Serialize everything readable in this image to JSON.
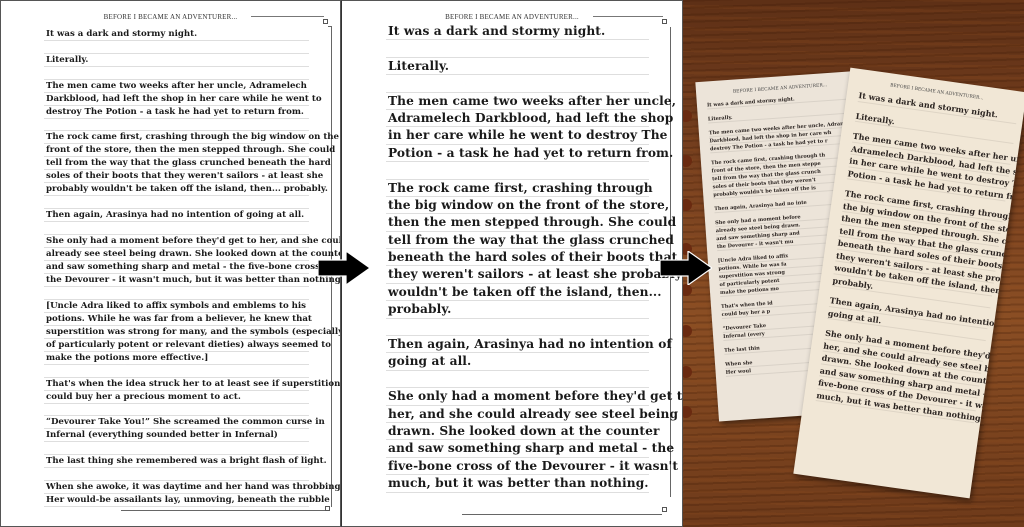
{
  "header": "BEFORE I BECAME AN ADVENTURER...",
  "left_page": {
    "paragraphs": [
      [
        "It was a dark and stormy night."
      ],
      [
        "Literally."
      ],
      [
        "The men came two weeks after her uncle, Adramelech",
        "Darkblood, had left the shop in her care while he went to",
        "destroy The Potion - a task he had yet to return from."
      ],
      [
        "The rock came first, crashing through the big window on the",
        "front of the store, then the men stepped through. She could",
        "tell from the way that the glass crunched beneath the hard",
        "soles of their boots that they weren't sailors - at least she",
        "probably wouldn't be taken off the island, then... probably."
      ],
      [
        "Then again, Arasinya had no intention of going at all."
      ],
      [
        "She only had a moment before they'd get to her, and she could",
        "already see steel being drawn. She looked down at the counter",
        "and saw something sharp and metal - the five-bone cross of",
        "the Devourer - it wasn't much, but it was better than nothing."
      ],
      [
        "[Uncle Adra liked to affix symbols and emblems to his",
        "potions. While he was far from a believer, he knew that",
        "superstition was strong for many, and the symbols (especially",
        "of particularly potent or relevant dieties) always seemed to",
        "make the potions more effective.]"
      ],
      [
        "That's when the idea struck her to at least see if superstition",
        "could buy her a precious moment to act."
      ],
      [
        "“Devourer Take You!” She screamed the common curse in",
        "Infernal (everything sounded better in Infernal)"
      ],
      [
        "The last thing she remembered was a bright flash of light."
      ],
      [
        "When she awoke, it was daytime and her hand was throbbing.",
        "Her would-be assailants lay, unmoving, beneath the rubble"
      ]
    ]
  },
  "mid_page": {
    "paragraphs": [
      [
        "It was a dark and stormy night."
      ],
      [
        "Literally."
      ],
      [
        "The men came two weeks after her uncle,",
        "Adramelech Darkblood, had left the shop",
        "in her care while he went to destroy The",
        "Potion - a task he had yet to return from."
      ],
      [
        "The rock came first, crashing through",
        "the big window on the front of the store,",
        "then the men stepped through. She could",
        "tell from the way that the glass crunched",
        "beneath the hard soles of their boots that",
        "they weren't sailors - at least she probably",
        "wouldn't be taken off the island, then...",
        "probably."
      ],
      [
        "Then again, Arasinya had no intention of",
        "going at all."
      ],
      [
        "She only had a moment before they'd get to",
        "her, and she could already see steel being",
        "drawn. She looked down at the counter",
        "and saw something sharp and metal - the",
        "five-bone cross of the Devourer - it wasn't",
        "much, but it was better than nothing."
      ]
    ]
  },
  "photo": {
    "back_sheet": {
      "paragraphs": [
        [
          "It was a dark and stormy night."
        ],
        [
          "Literally."
        ],
        [
          "The men came two weeks after her uncle, Adrame",
          "Darkblood, had left the shop in her care wh",
          "destroy The Potion - a task he had yet to r"
        ],
        [
          "The rock came first, crashing through th",
          "front of the store, then the men steppe",
          "tell from the way that the glass crunch",
          "soles of their boots that they weren't",
          "probably wouldn't be taken off the is"
        ],
        [
          "Then again, Arasinya had no inte"
        ],
        [
          "She only had a moment before",
          "already see steel being drawn.",
          "and saw something sharp and",
          "the Devourer - it wasn't mu"
        ],
        [
          "[Uncle Adra liked to affix",
          "potions. While he was fa",
          "superstition was strong",
          "of particularly potent",
          "make the potions mo"
        ],
        [
          "That's when the id",
          "could buy her a p"
        ],
        [
          "“Devourer Take",
          "Infernal (every"
        ],
        [
          "The last thin"
        ],
        [
          "When she",
          "Her woul"
        ]
      ]
    },
    "front_sheet": {
      "paragraphs": [
        [
          "It was a dark and stormy night."
        ],
        [
          "Literally."
        ],
        [
          "The men came two weeks after her uncle,",
          "Adramelech Darkblood, had left the shop",
          "in her care while he went to destroy The",
          "Potion - a task he had yet to return from."
        ],
        [
          "The rock came first, crashing through",
          "the big window on the front of the store,",
          "then the men stepped through. She could",
          "tell from the way that the glass crunched",
          "beneath the hard soles of their boots that",
          "they weren't sailors - at least she probably",
          "wouldn't be taken off the island, then...",
          "probably."
        ],
        [
          "Then again, Arasinya had no intention of",
          "going at all."
        ],
        [
          "She only had a moment before they'd get to",
          "her, and she could already see steel being",
          "drawn. She looked down at the counter",
          "and saw something sharp and metal - the",
          "five-bone cross of the Devourer - it wasn't",
          "much, but it was better than nothing."
        ]
      ]
    }
  },
  "arrows": [
    "arrow-right-icon",
    "arrow-right-icon"
  ],
  "colors": {
    "ink": "#1a1a1a",
    "rule": "#dedede",
    "paper": "#f1e7d6",
    "wood": "#7a4220",
    "arrow": "#000000"
  }
}
